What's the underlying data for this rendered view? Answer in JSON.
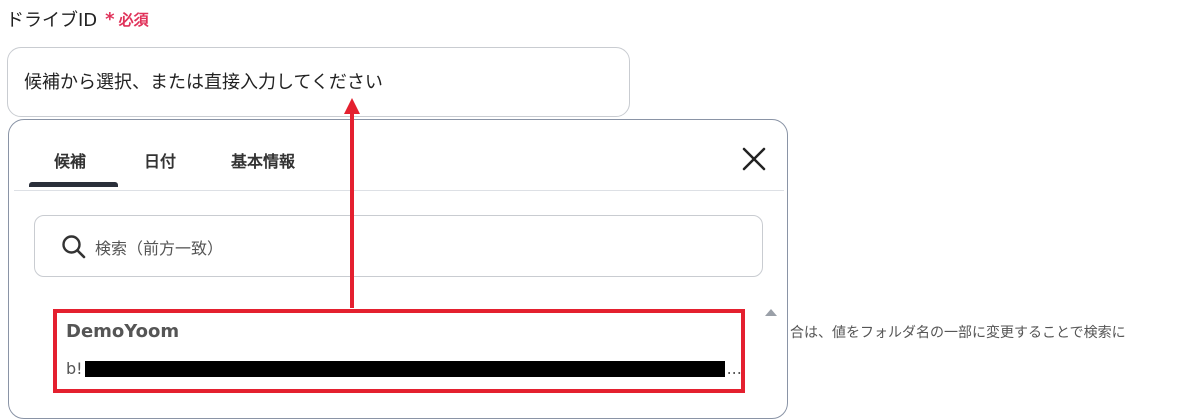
{
  "field": {
    "label": "ドライブID",
    "required_star": "*",
    "required_text": "必須",
    "placeholder": "候補から選択、または直接入力してください"
  },
  "dropdown": {
    "tabs": [
      {
        "label": "候補",
        "active": true
      },
      {
        "label": "日付",
        "active": false
      },
      {
        "label": "基本情報",
        "active": false
      }
    ],
    "close_icon": "close-icon",
    "search": {
      "icon": "search-icon",
      "placeholder": "検索（前方一致）"
    },
    "results": [
      {
        "title": "DemoYoom",
        "id_prefix": "b!",
        "id_suffix": "..."
      }
    ]
  },
  "background_text": "合は、値をフォルダ名の一部に変更することで検索に",
  "colors": {
    "required": "#e0325a",
    "highlight": "#e4202f",
    "tab_indicator": "#2a2f3a"
  }
}
